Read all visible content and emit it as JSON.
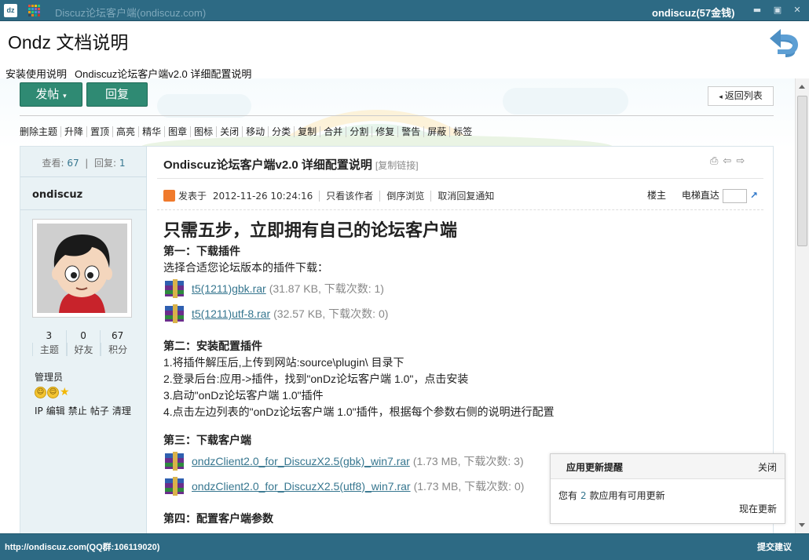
{
  "window": {
    "logo": "dz",
    "title": "Discuz论坛客户端(ondiscuz.com)",
    "user": "ondiscuz(57金钱)",
    "controls": [
      "▬",
      "▣",
      "✕"
    ]
  },
  "header": {
    "title": "Ondz 文档说明",
    "breadcrumb": [
      "安装使用说明",
      "Ondiscuz论坛客户端v2.0 详细配置说明"
    ]
  },
  "actions": {
    "post_label": "发帖",
    "reply_label": "回复",
    "return_label": "返回列表"
  },
  "modbar": [
    "删除主题",
    "升降",
    "置顶",
    "高亮",
    "精华",
    "图章",
    "图标",
    "关闭",
    "移动",
    "分类",
    "复制",
    "合并",
    "分割",
    "修复",
    "警告",
    "屏蔽",
    "标签"
  ],
  "sidebar": {
    "views_label": "查看:",
    "views": "67",
    "replies_label": "回复:",
    "replies": "1",
    "username": "ondiscuz",
    "counts": [
      {
        "value": "3",
        "label": "主题"
      },
      {
        "value": "0",
        "label": "好友"
      },
      {
        "value": "67",
        "label": "积分"
      }
    ],
    "role": "管理员",
    "admin_links": [
      "IP",
      "编辑",
      "禁止",
      "帖子",
      "清理"
    ]
  },
  "post": {
    "title": "Ondiscuz论坛客户端v2.0 详细配置说明",
    "copy_link": "[复制链接]",
    "posted_label": "发表于",
    "posted_time": "2012-11-26 10:24:16",
    "meta_links": [
      "只看该作者",
      "倒序浏览",
      "取消回复通知"
    ],
    "floor_label": "楼主",
    "jump_label": "电梯直达"
  },
  "content": {
    "heading": "只需五步，立即拥有自己的论坛客户端",
    "step1_title": "第一：下载插件",
    "step1_desc": "选择合适您论坛版本的插件下载：",
    "step1_files": [
      {
        "name": "t5(1211)gbk.rar",
        "info": "(31.87 KB, 下载次数: 1)"
      },
      {
        "name": "t5(1211)utf-8.rar",
        "info": "(32.57 KB, 下载次数: 0)"
      }
    ],
    "step2_title": "第二：安装配置插件",
    "step2_lines": [
      "1.将插件解压后,上传到网站:source\\plugin\\ 目录下",
      "2.登录后台:应用->插件，找到\"onDz论坛客户端 1.0\"，点击安装",
      "3.启动\"onDz论坛客户端 1.0\"插件",
      "4.点击左边列表的\"onDz论坛客户端 1.0\"插件，根据每个参数右侧的说明进行配置"
    ],
    "step3_title": "第三：下载客户端",
    "step3_files": [
      {
        "name": "ondzClient2.0_for_DiscuzX2.5(gbk)_win7.rar",
        "info": "(1.73 MB, 下载次数: 3)"
      },
      {
        "name": "ondzClient2.0_for_DiscuzX2.5(utf8)_win7.rar",
        "info": "(1.73 MB, 下载次数: 0)"
      }
    ],
    "step4_title": "第四：配置客户端参数"
  },
  "notice": {
    "title": "应用更新提醒",
    "close": "关闭",
    "body_prefix": "您有",
    "count": "2",
    "body_suffix": "款应用有可用更新",
    "update": "现在更新"
  },
  "statusbar": {
    "url": "http://ondiscuz.com(QQ群:106119020)",
    "suggest": "提交建议"
  },
  "colors": {
    "chrome": "#2d6a84",
    "button": "#2f8a73",
    "link": "#36768f",
    "sidebar_bg": "#e9f2f5"
  }
}
